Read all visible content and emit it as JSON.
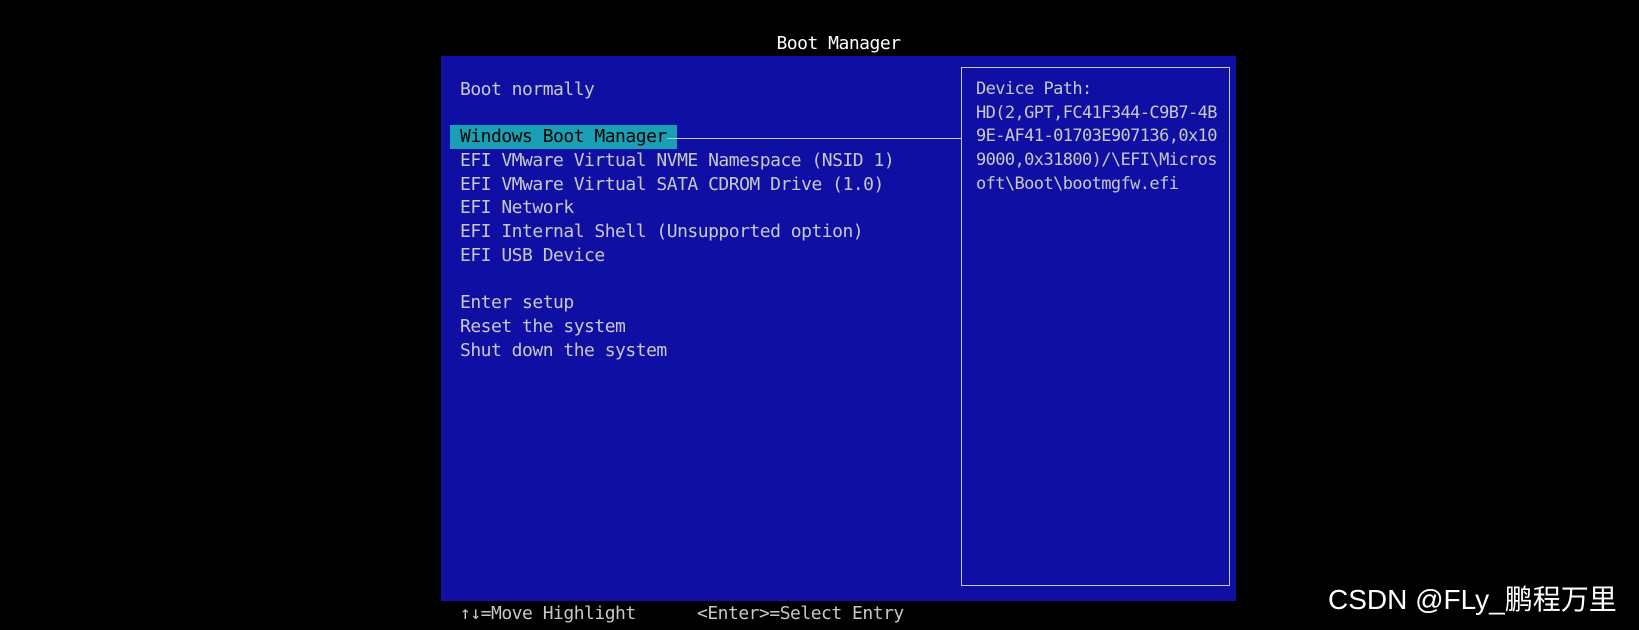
{
  "header": {
    "title": "Boot Manager"
  },
  "menu": {
    "boot_normally": "Boot normally",
    "boot_entries": [
      "Windows Boot Manager",
      "EFI VMware Virtual NVME Namespace (NSID 1)",
      "EFI VMware Virtual SATA CDROM Drive (1.0)",
      "EFI Network",
      "EFI Internal Shell (Unsupported option)",
      "EFI USB Device"
    ],
    "selected_entry": "Windows Boot Manager",
    "actions": [
      "Enter setup",
      "Reset the system",
      "Shut down the system"
    ]
  },
  "info_panel": {
    "label": "Device Path:",
    "value": "HD(2,GPT,FC41F344-C9B7-4B9E-AF41-01703E907136,0x109000,0x31800)/\\EFI\\Microsoft\\Boot\\bootmgfw.efi"
  },
  "footer": {
    "hint_move": "↑↓=Move Highlight",
    "hint_select": "<Enter>=Select Entry"
  },
  "watermark": {
    "text": "CSDN @FLy_鹏程万里"
  },
  "colors": {
    "background": "#000000",
    "panel": "#0f0fa3",
    "text": "#c8c8c8",
    "highlight": "#1aa0b4",
    "title": "#ffffff"
  }
}
